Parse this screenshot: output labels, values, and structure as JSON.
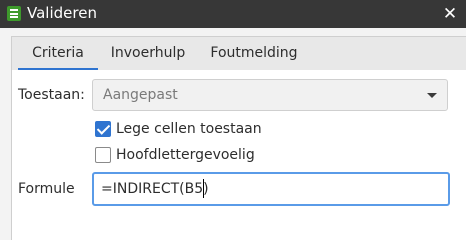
{
  "window": {
    "title": "Valideren",
    "app_icon": "spreadsheet-icon",
    "close_icon": "close-icon"
  },
  "tabs": [
    {
      "label": "Criteria",
      "active": true
    },
    {
      "label": "Invoerhulp",
      "active": false
    },
    {
      "label": "Foutmelding",
      "active": false
    }
  ],
  "form": {
    "allow_label": "Toestaan:",
    "allow_value": "Aangepast",
    "ignore_blank_label": "Lege cellen toestaan",
    "ignore_blank_checked": true,
    "case_sensitive_label": "Hoofdlettergevoelig",
    "case_sensitive_checked": false,
    "formula_label": "Formule",
    "formula_value": "=INDIRECT(B5)"
  },
  "colors": {
    "accent": "#2f74d0",
    "titlebar": "#373737"
  }
}
